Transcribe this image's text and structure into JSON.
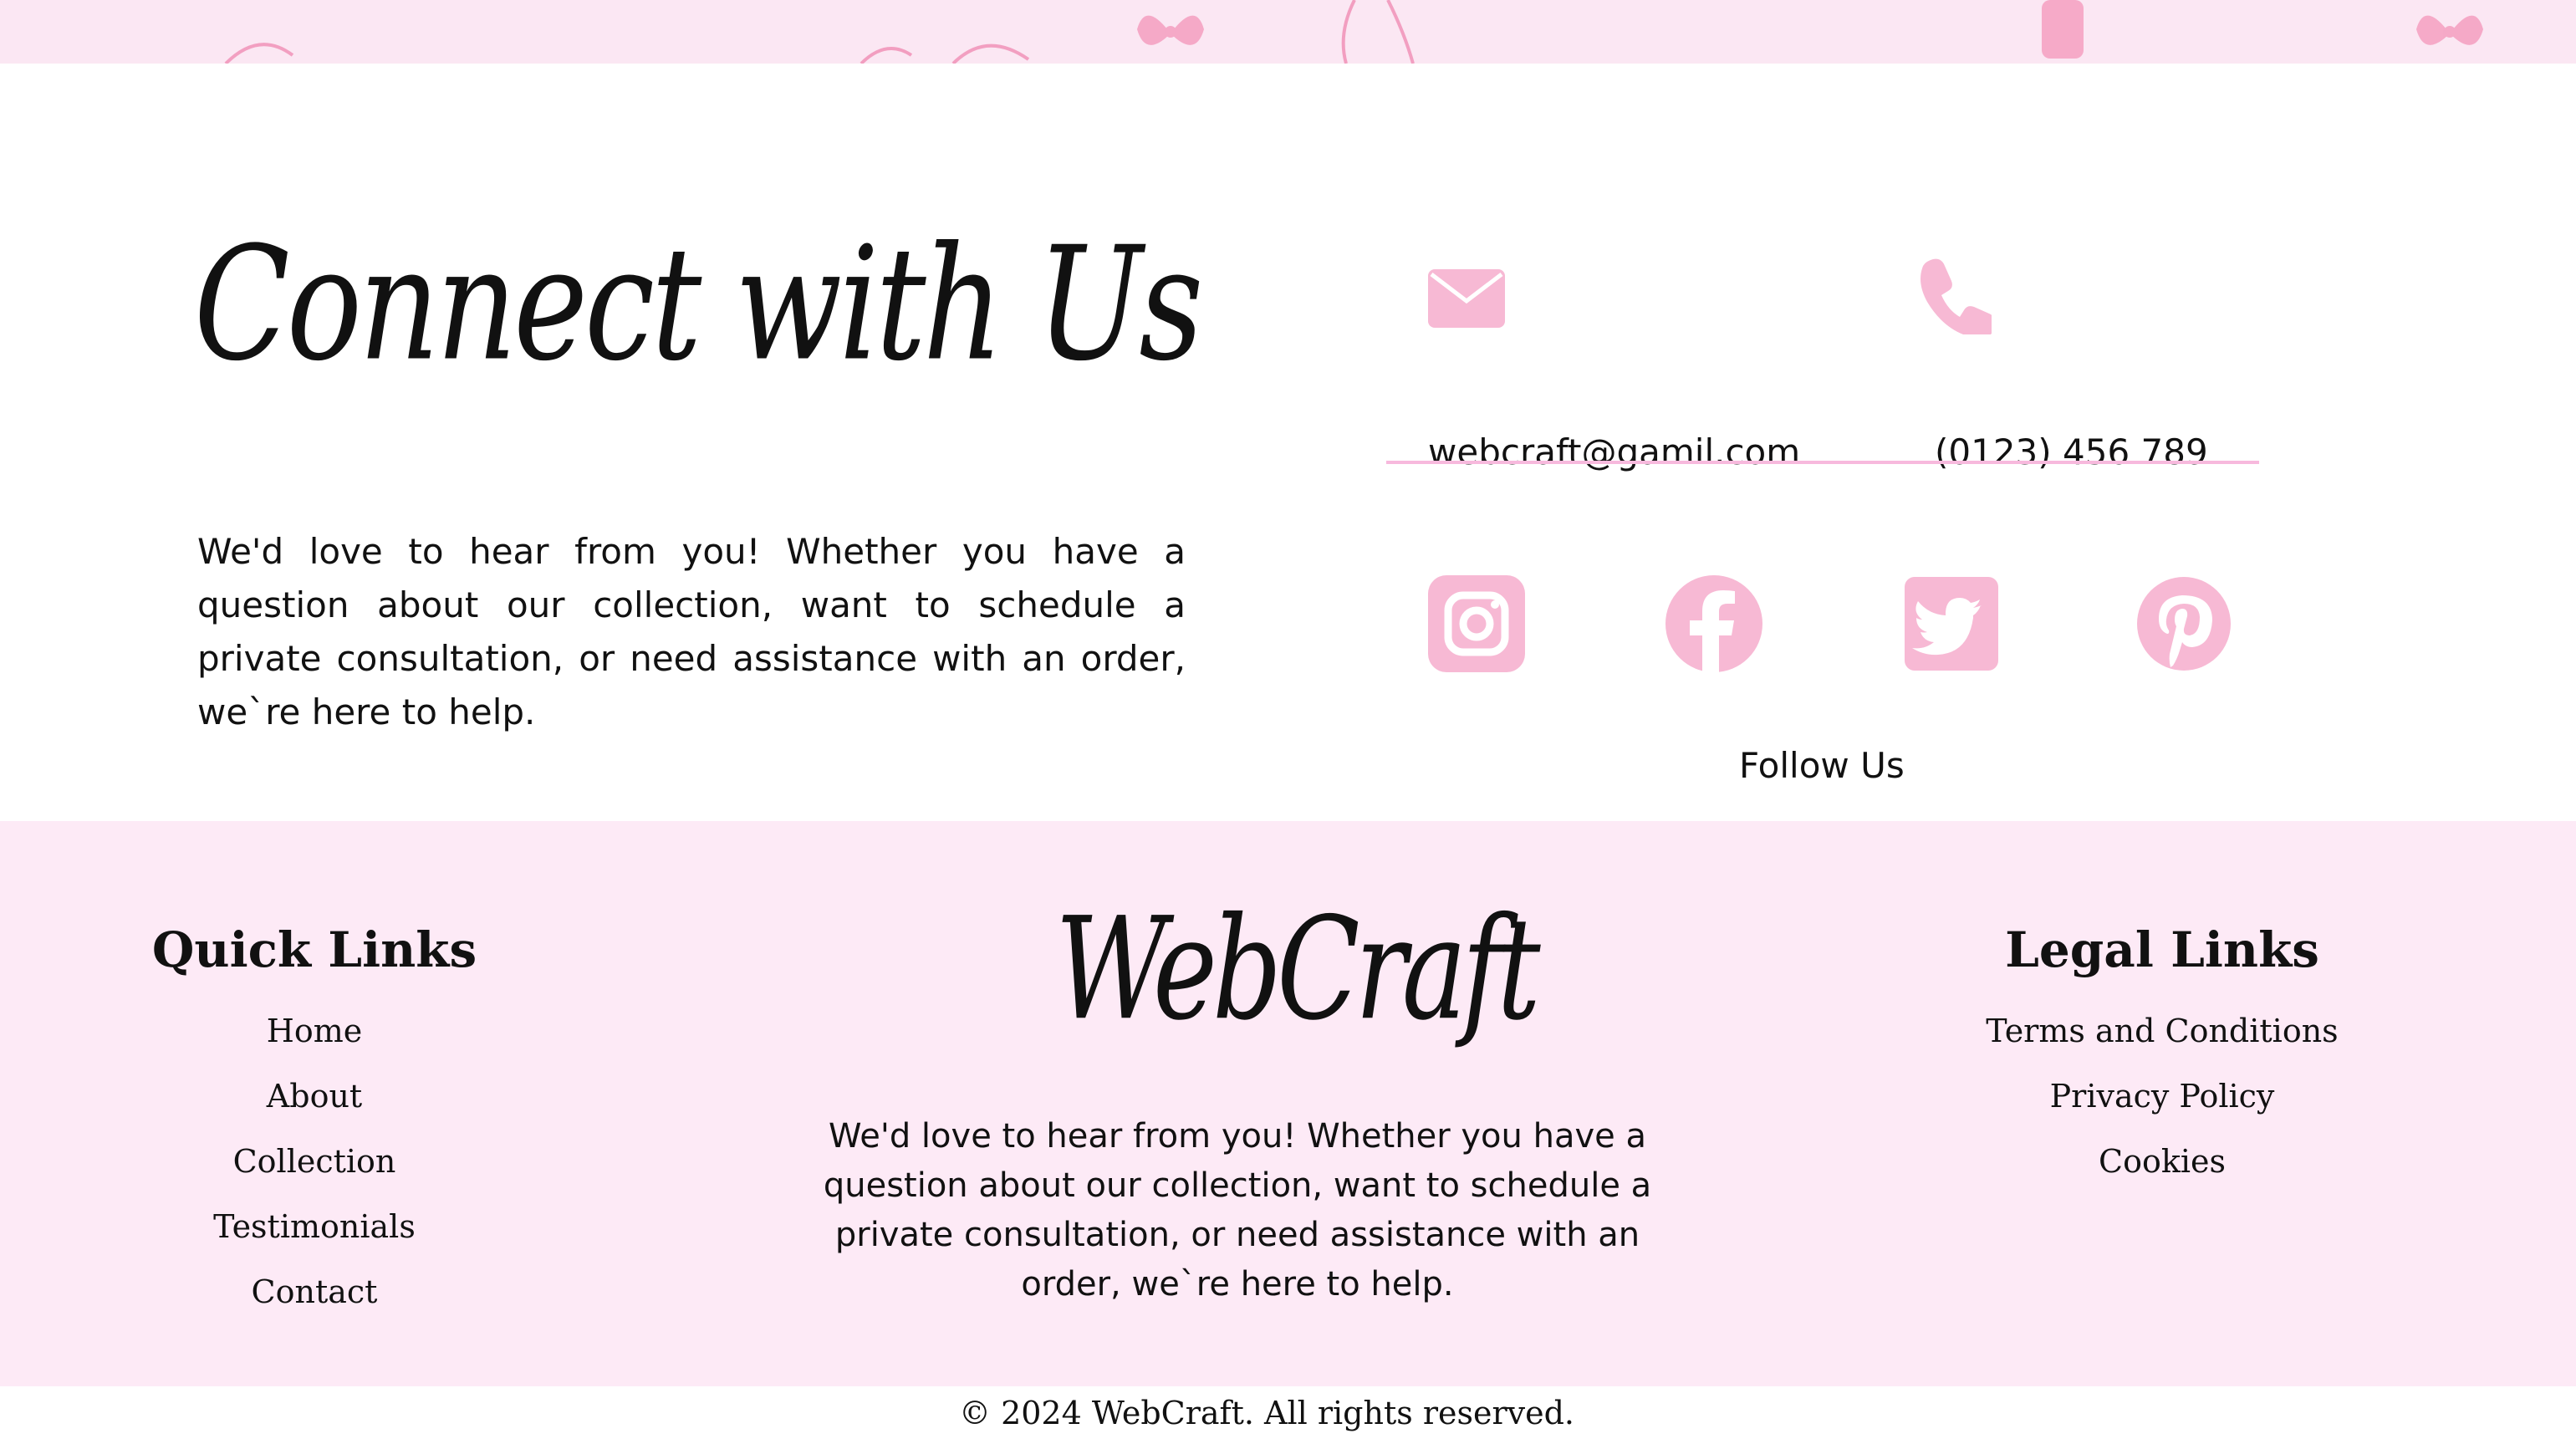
{
  "connect": {
    "title": "Connect with Us",
    "text": "We'd love to hear from you! Whether you have a question about our collection, want to schedule a private consultation, or need assistance with an order, weˋre here to help.",
    "email": "webcraft@gamil.com",
    "phone": "(0123) 456 789",
    "follow_label": "Follow Us",
    "icons": [
      "mail-icon",
      "phone-icon",
      "instagram-icon",
      "facebook-icon",
      "twitter-icon",
      "pinterest-icon"
    ]
  },
  "footer": {
    "quick_links": {
      "heading": "Quick Links",
      "items": [
        "Home",
        "About",
        "Collection",
        "Testimonials",
        "Contact"
      ]
    },
    "brand": {
      "logo": "WebCraft",
      "text": "We'd love to hear from you! Whether you have a question about our collection, want to schedule a private consultation, or need assistance with an order, weˋre here to help."
    },
    "legal_links": {
      "heading": "Legal Links",
      "items": [
        "Terms and Conditions",
        "Privacy Policy",
        "Cookies"
      ]
    },
    "copyright": "© 2024 WebCraft. All rights reserved."
  },
  "colors": {
    "accent_pink": "#f7b9d4",
    "footer_bg": "#fdeaf6",
    "divider": "#f7b9dd",
    "text": "#111111"
  }
}
